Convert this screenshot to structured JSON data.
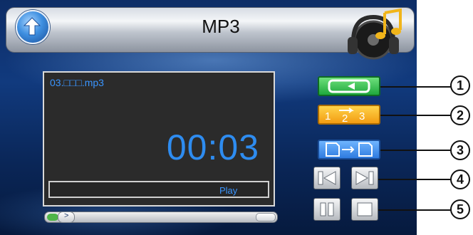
{
  "header": {
    "title": "MP3"
  },
  "player": {
    "filename": "03.□□□.mp3",
    "time": "00:03",
    "status": "Play",
    "progress": 0.05
  },
  "buttons": {
    "order_label": "1 2 3"
  },
  "callouts": [
    "1",
    "2",
    "3",
    "4",
    "5"
  ]
}
